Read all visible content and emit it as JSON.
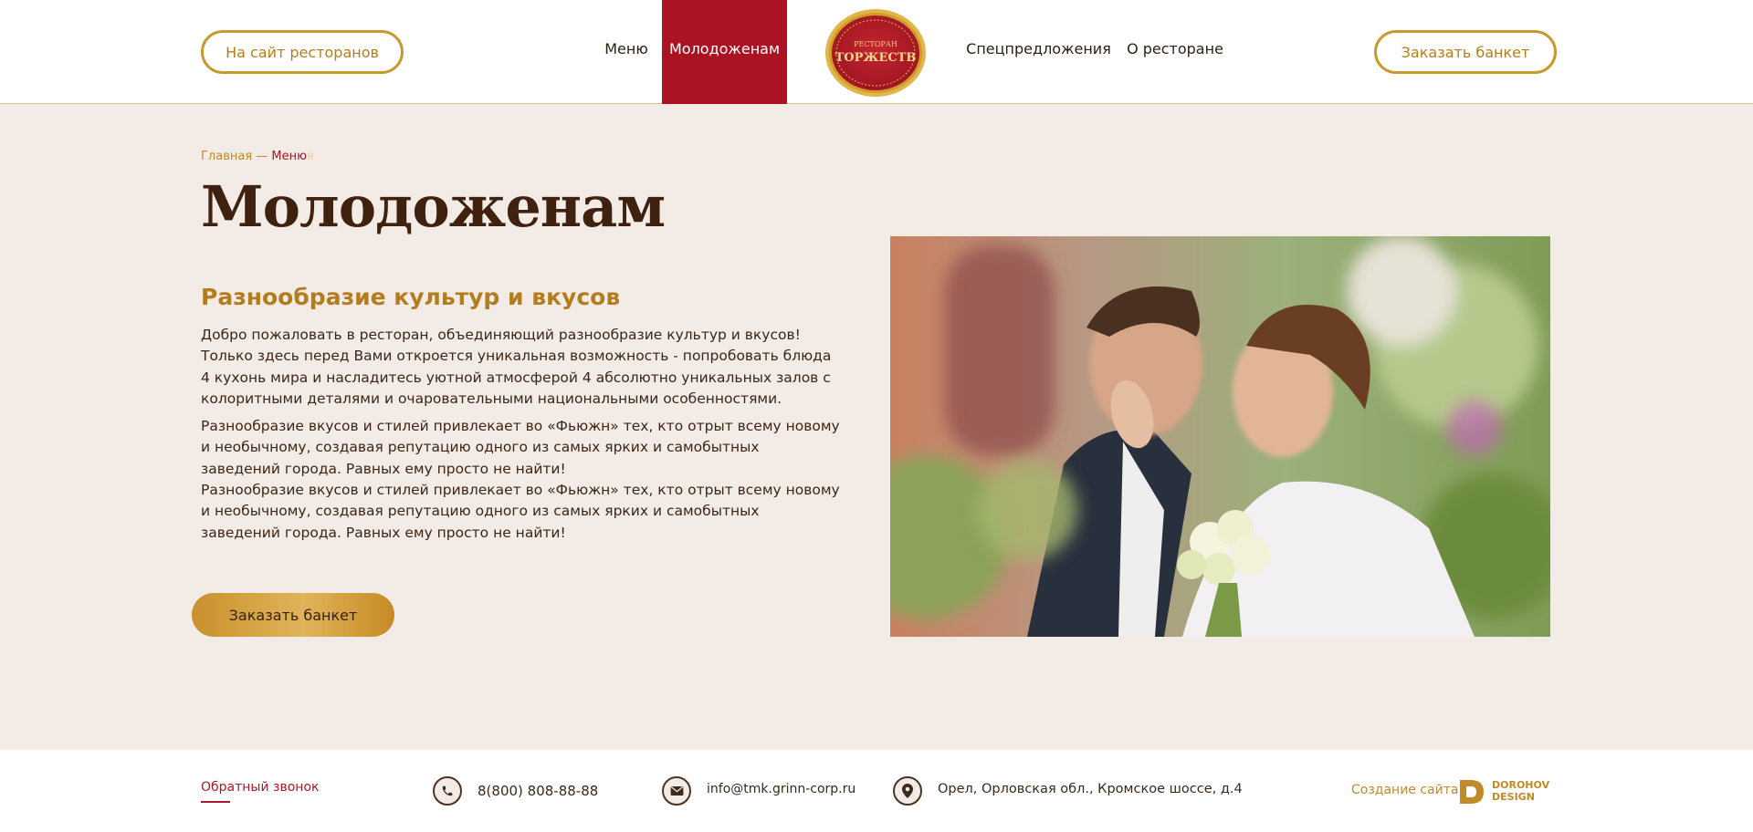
{
  "header": {
    "sites_button": "На сайт ресторанов",
    "order_button": "Заказать банкет",
    "nav": {
      "menu": "Меню",
      "newlyweds": "Молодоженам",
      "special": "Спецпредложения",
      "about": "О ресторане"
    },
    "logo": {
      "top_text": "РЕСТОРАН",
      "main_text": "ТОРЖЕСТВ"
    }
  },
  "breadcrumb": {
    "home": "Главная",
    "separator": " — ",
    "current": "Меню",
    "ghost": "я"
  },
  "main": {
    "title": "Молодоженам",
    "subtitle": "Разнообразие культур и вкусов",
    "paragraph1": "Добро пожаловать в ресторан, объединяющий разнообразие культур и вкусов! Только здесь перед Вами откроется уникальная возможность - попробовать блюда 4 кухонь мира и насладитесь уютной атмосферой 4 абсолютно уникальных залов с колоритными деталями и очаровательными национальными особенностями.",
    "paragraph2": "Разнообразие вкусов и стилей привлекает во «Фьюжн» тех, кто отрыт всему новому и необычному, создавая репутацию одного из самых ярких и самобытных заведений города. Равных ему просто не найти!",
    "paragraph3": "Разнообразие вкусов и стилей привлекает во «Фьюжн» тех, кто отрыт всему новому и необычному, создавая репутацию одного из самых ярких и самобытных заведений города. Равных ему просто не найти!",
    "order_button": "Заказать банкет"
  },
  "footer": {
    "callback": "Обратный звонок",
    "phone": "8(800) 808-88-88",
    "email": "info@tmk.grinn-corp.ru",
    "address": "Орел, Орловская обл., Кромское шоссе, д.4",
    "credit": "Создание сайта -",
    "studio_line1": "DOROHOV",
    "studio_line2": "DESIGN"
  },
  "colors": {
    "accent_red": "#ac1322",
    "gold": "#c89a2e",
    "background": "#f3ebe6",
    "dark_brown": "#3e210f"
  },
  "icons": [
    "phone-icon",
    "mail-icon",
    "location-pin-icon"
  ]
}
